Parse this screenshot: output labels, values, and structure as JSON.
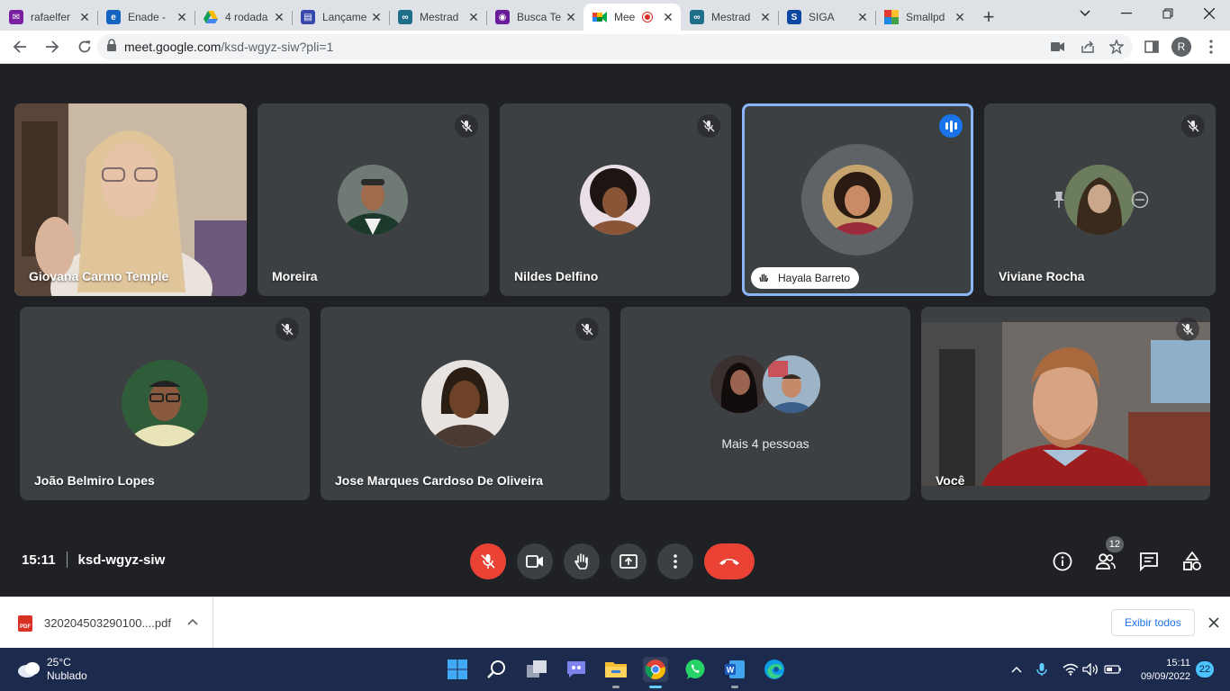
{
  "browser": {
    "tabs": [
      {
        "title": "rafaelfer",
        "favicon": "gmail-icon",
        "color": "#7b1fa2"
      },
      {
        "title": "Enade -",
        "favicon": "edge-e-icon",
        "color": "#1565c0"
      },
      {
        "title": "4 rodada",
        "favicon": "drive-icon",
        "color": "#fbbc04"
      },
      {
        "title": "Lançame",
        "favicon": "forms-icon",
        "color": "#3949ab"
      },
      {
        "title": "Mestrad",
        "favicon": "glasses-icon",
        "color": "#1f6f8b"
      },
      {
        "title": "Busca Te",
        "favicon": "mask-icon",
        "color": "#6a1b9a"
      },
      {
        "title": "Mee",
        "favicon": "meet-icon",
        "color": "#00832d",
        "active": true
      },
      {
        "title": "Mestrad",
        "favicon": "glasses-icon",
        "color": "#1f6f8b"
      },
      {
        "title": "SIGA",
        "favicon": "siga-s-icon",
        "color": "#0d47a1"
      },
      {
        "title": "Smallpd",
        "favicon": "smallpdf-icon",
        "color": "#e53935"
      }
    ],
    "url_host": "meet.google.com",
    "url_path": "/ksd-wgyz-siw?pli=1",
    "profile_initial": "R"
  },
  "meet": {
    "participants": [
      {
        "name": "Giovana Carmo Temple",
        "type": "video"
      },
      {
        "name": "Moreira",
        "type": "avatar",
        "muted": true
      },
      {
        "name": "Nildes Delfino",
        "type": "avatar",
        "muted": true
      },
      {
        "name": "Hayala Barreto",
        "type": "avatar",
        "speaking": true
      },
      {
        "name": "Viviane Rocha",
        "type": "avatar",
        "muted": true
      },
      {
        "name": "João Belmiro Lopes",
        "type": "avatar",
        "muted": true
      },
      {
        "name": "Jose Marques Cardoso De Oliveira",
        "type": "avatar",
        "muted": true
      },
      {
        "name": "Mais 4 pessoas",
        "type": "group"
      },
      {
        "name": "Você",
        "type": "video",
        "muted": true
      }
    ],
    "time": "15:11",
    "meeting_code": "ksd-wgyz-siw",
    "people_count": "12",
    "accent_red": "#ea4335",
    "accent_blue": "#8ab4f8"
  },
  "downloads": {
    "file_name": "320204503290100....pdf",
    "show_all_label": "Exibir todos",
    "pdf_label": "PDF"
  },
  "taskbar": {
    "temperature": "25°C",
    "weather": "Nublado",
    "clock_time": "15:11",
    "clock_date": "09/09/2022",
    "notifications": "22"
  }
}
